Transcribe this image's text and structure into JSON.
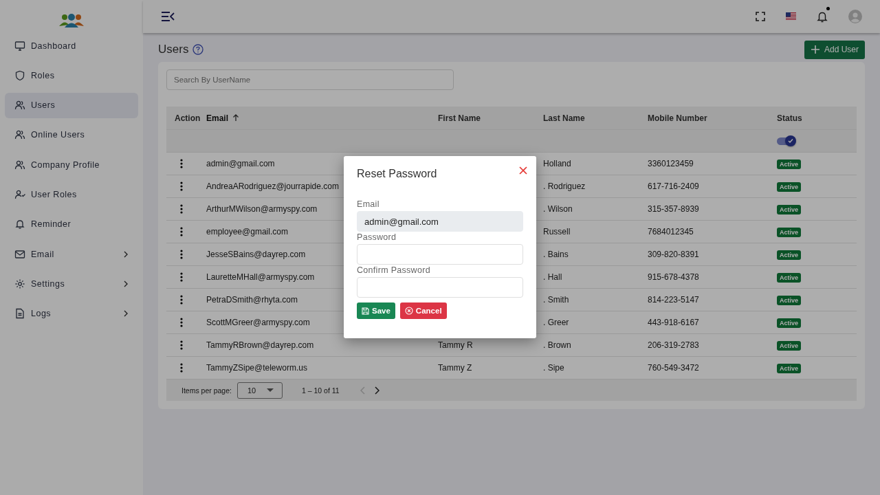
{
  "sidebar": {
    "items": [
      {
        "label": "Dashboard",
        "selected": false,
        "has_submenu": false
      },
      {
        "label": "Roles",
        "selected": false,
        "has_submenu": false
      },
      {
        "label": "Users",
        "selected": true,
        "has_submenu": false
      },
      {
        "label": "Online Users",
        "selected": false,
        "has_submenu": false
      },
      {
        "label": "Company Profile",
        "selected": false,
        "has_submenu": false
      },
      {
        "label": "User Roles",
        "selected": false,
        "has_submenu": false
      },
      {
        "label": "Reminder",
        "selected": false,
        "has_submenu": false
      },
      {
        "label": "Email",
        "selected": false,
        "has_submenu": true
      },
      {
        "label": "Settings",
        "selected": false,
        "has_submenu": true
      },
      {
        "label": "Logs",
        "selected": false,
        "has_submenu": true
      }
    ]
  },
  "topbar": {
    "notification_dot": true
  },
  "page": {
    "title": "Users",
    "add_button": "Add User"
  },
  "search": {
    "placeholder": "Search By UserName"
  },
  "table": {
    "columns": [
      {
        "label": "Action",
        "sorted": false
      },
      {
        "label": "Email",
        "sorted": true
      },
      {
        "label": "First Name",
        "sorted": false
      },
      {
        "label": "Last Name",
        "sorted": false
      },
      {
        "label": "Mobile Number",
        "sorted": false
      },
      {
        "label": "Status",
        "sorted": false
      }
    ],
    "status_filter": {
      "on": true
    },
    "rows": [
      {
        "email": "admin@gmail.com",
        "last_name": "Holland",
        "mobile": "3360123459",
        "status": "Active"
      },
      {
        "email": "AndreaARodriguez@jourrapide.com",
        "last_name": ". Rodriguez",
        "mobile": "617-716-2409",
        "status": "Active"
      },
      {
        "email": "ArthurMWilson@armyspy.com",
        "last_name": ". Wilson",
        "mobile": "315-357-8939",
        "status": "Active"
      },
      {
        "email": "employee@gmail.com",
        "last_name": "Russell",
        "mobile": "7684012345",
        "status": "Active"
      },
      {
        "email": "JesseSBains@dayrep.com",
        "last_name": ". Bains",
        "mobile": "309-820-8391",
        "status": "Active"
      },
      {
        "email": "LauretteMHall@armyspy.com",
        "last_name": ". Hall",
        "mobile": "915-678-4378",
        "status": "Active"
      },
      {
        "email": "PetraDSmith@rhyta.com",
        "last_name": ". Smith",
        "mobile": "814-223-5147",
        "status": "Active"
      },
      {
        "email": "ScottMGreer@armyspy.com",
        "last_name": ". Greer",
        "mobile": "443-918-6167",
        "status": "Active"
      },
      {
        "email": "TammyRBrown@dayrep.com",
        "first_name": "Tammy R",
        "last_name": ". Brown",
        "mobile": "206-319-2783",
        "status": "Active"
      },
      {
        "email": "TammyZSipe@teleworm.us",
        "first_name": "Tammy Z",
        "last_name": ". Sipe",
        "mobile": "760-549-3472",
        "status": "Active"
      }
    ]
  },
  "paginator": {
    "label": "Items per page:",
    "page_size": "10",
    "range": "1 – 10 of 11",
    "prev_disabled": true,
    "next_disabled": false
  },
  "dialog": {
    "title": "Reset Password",
    "fields": [
      {
        "label": "Email",
        "value": "admin@gmail.com",
        "disabled": true
      },
      {
        "label": "Password",
        "disabled": false
      },
      {
        "label": "Confirm Password",
        "disabled": false
      }
    ],
    "save": "Save",
    "cancel": "Cancel"
  }
}
